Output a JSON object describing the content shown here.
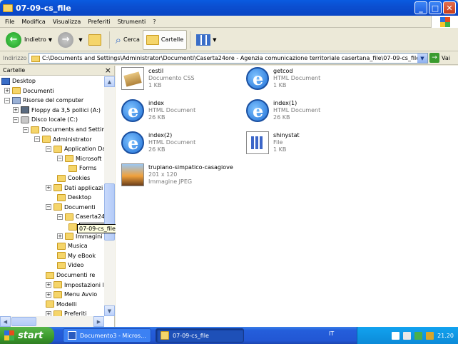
{
  "window": {
    "title": "07-09-cs_file"
  },
  "menu": [
    "File",
    "Modifica",
    "Visualizza",
    "Preferiti",
    "Strumenti",
    "?"
  ],
  "toolbar": {
    "back": "Indietro",
    "search": "Cerca",
    "folders": "Cartelle"
  },
  "address": {
    "label": "Indirizzo",
    "path": "C:\\Documents and Settings\\Administrator\\Documenti\\Caserta24ore - Agenzia comunicazione territoriale casertana_file\\07-09-cs_file",
    "go": "Vai"
  },
  "panel": {
    "title": "Cartelle",
    "close": "×"
  },
  "tree": [
    {
      "label": "Desktop",
      "icon": "desktop-icon"
    },
    {
      "label": "Documenti",
      "icon": "folder-icon",
      "exp": "+"
    },
    {
      "label": "Risorse del computer",
      "icon": "computer-icon",
      "exp": "−"
    },
    {
      "label": "Floppy da 3,5 pollici (A:)",
      "icon": "floppy-icon",
      "exp": "+"
    },
    {
      "label": "Disco locale (C:)",
      "icon": "disk-icon",
      "exp": "−"
    },
    {
      "label": "Documents and Settin",
      "icon": "folder-icon",
      "exp": "−"
    },
    {
      "label": "Administrator",
      "icon": "folder-icon",
      "exp": "−"
    },
    {
      "label": "Application Da",
      "icon": "folder-icon",
      "exp": "−"
    },
    {
      "label": "Microsoft",
      "icon": "folder-icon",
      "exp": "−"
    },
    {
      "label": "Forms",
      "icon": "folder-icon"
    },
    {
      "label": "Cookies",
      "icon": "folder-icon"
    },
    {
      "label": "Dati applicazi",
      "icon": "folder-icon",
      "exp": "+"
    },
    {
      "label": "Desktop",
      "icon": "folder-icon"
    },
    {
      "label": "Documenti",
      "icon": "folder-icon",
      "exp": "−"
    },
    {
      "label": "Caserta24",
      "icon": "folder-icon",
      "exp": "−"
    },
    {
      "label": "07-09-cs_file",
      "icon": "folder-icon"
    },
    {
      "label": "Immagini",
      "icon": "folder-icon",
      "exp": "+"
    },
    {
      "label": "Musica",
      "icon": "folder-icon"
    },
    {
      "label": "My eBook",
      "icon": "folder-icon"
    },
    {
      "label": "Video",
      "icon": "folder-icon"
    },
    {
      "label": "Documenti re",
      "icon": "folder-icon"
    },
    {
      "label": "Impostazioni l",
      "icon": "folder-icon",
      "exp": "+"
    },
    {
      "label": "Menu Avvio",
      "icon": "folder-icon",
      "exp": "+"
    },
    {
      "label": "Modelli",
      "icon": "folder-icon"
    },
    {
      "label": "Preferiti",
      "icon": "folder-icon",
      "exp": "+"
    }
  ],
  "tooltip": "07-09-cs_file",
  "files": [
    {
      "name": "cestil",
      "type": "Documento CSS",
      "size": "1 KB",
      "icon": "css-icon"
    },
    {
      "name": "getcod",
      "type": "HTML Document",
      "size": "1 KB",
      "icon": "ie-icon"
    },
    {
      "name": "index",
      "type": "HTML Document",
      "size": "26 KB",
      "icon": "ie-icon"
    },
    {
      "name": "index(1)",
      "type": "HTML Document",
      "size": "26 KB",
      "icon": "ie-icon"
    },
    {
      "name": "index(2)",
      "type": "HTML Document",
      "size": "26 KB",
      "icon": "ie-icon"
    },
    {
      "name": "shinystat",
      "type": "File",
      "size": "1 KB",
      "icon": "generic-file-icon"
    },
    {
      "name": "trupiano-simpatico-casagiove",
      "type": "201 x 120",
      "size": "Immagine JPEG",
      "icon": "jpeg-icon"
    }
  ],
  "taskbar": {
    "start": "start",
    "tasks": [
      {
        "label": "Documento3 - Micros..."
      },
      {
        "label": "07-09-cs_file"
      }
    ],
    "lang": "IT",
    "clock": "21.20"
  }
}
